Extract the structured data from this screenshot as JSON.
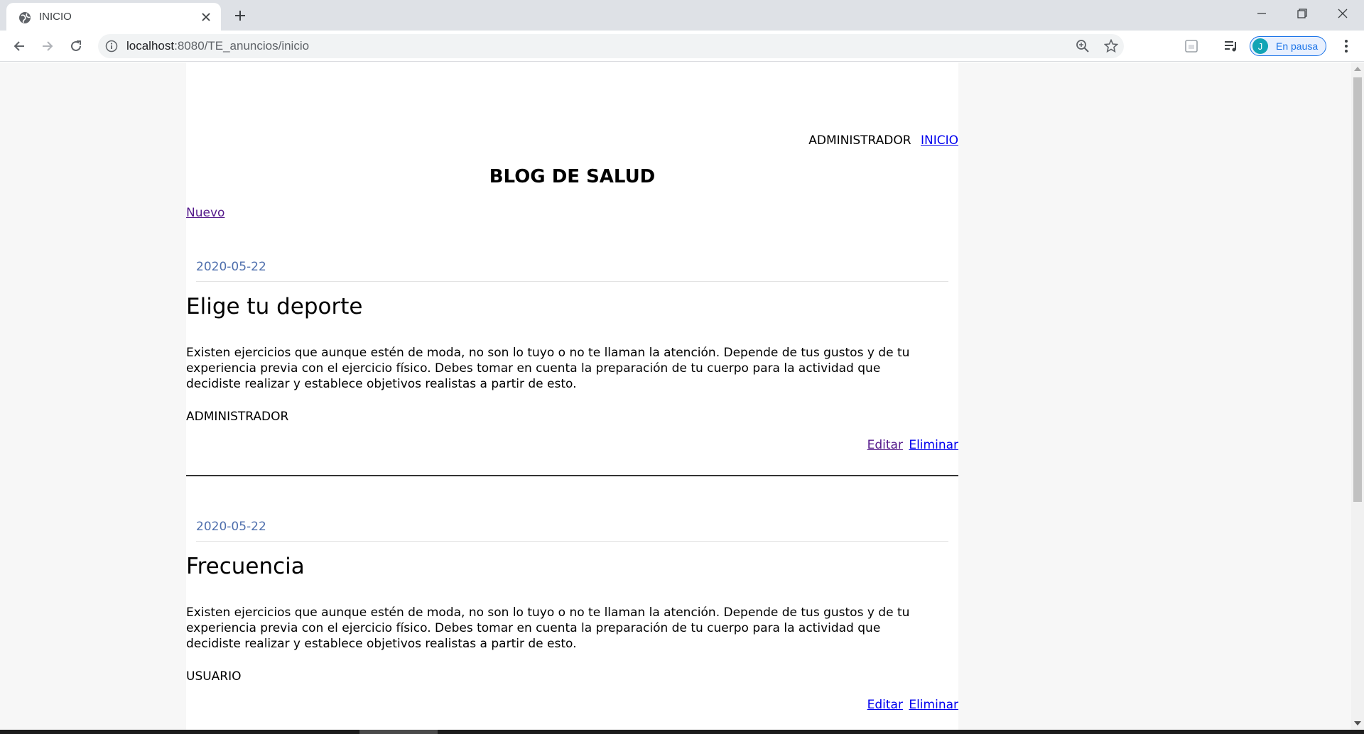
{
  "browser": {
    "tab_title": "INICIO",
    "url_host": "localhost",
    "url_rest": ":8080/TE_anuncios/inicio",
    "profile_initial": "J",
    "profile_label": "En pausa"
  },
  "header": {
    "role": "ADMINISTRADOR",
    "home_link": "INICIO"
  },
  "blog": {
    "title": "BLOG DE SALUD",
    "new_link": "Nuevo"
  },
  "posts": [
    {
      "date": "2020-05-22",
      "title": "Elige tu deporte",
      "body": "Existen ejercicios que aunque estén de moda, no son lo tuyo o no te llaman la atención. Depende de tus gustos y de tu experiencia previa con el ejercicio físico. Debes tomar en cuenta la preparación de tu cuerpo para la actividad que decidiste realizar y establece objetivos realistas a partir de esto.",
      "author": "ADMINISTRADOR",
      "edit_label": "Editar",
      "delete_label": "Eliminar"
    },
    {
      "date": "2020-05-22",
      "title": "Frecuencia",
      "body": "Existen ejercicios que aunque estén de moda, no son lo tuyo o no te llaman la atención. Depende de tus gustos y de tu experiencia previa con el ejercicio físico. Debes tomar en cuenta la preparación de tu cuerpo para la actividad que decidiste realizar y establece objetivos realistas a partir de esto.",
      "author": "USUARIO",
      "edit_label": "Editar",
      "delete_label": "Eliminar"
    }
  ],
  "icons": {
    "favicon": "globe-icon",
    "tab_close": "close-icon",
    "new_tab": "plus-icon",
    "back": "arrow-left-icon",
    "forward": "arrow-right-icon",
    "reload": "reload-icon",
    "site_info": "info-icon",
    "zoom": "zoom-icon",
    "bookmark": "star-icon",
    "extension": "extension-icon",
    "media": "media-control-icon",
    "menu": "kebab-menu-icon"
  },
  "colors": {
    "link": "#0000ee",
    "visited_link": "#551a8b",
    "date": "#4f6fad",
    "chrome_bg": "#dee1e6",
    "profile_accent": "#1a73e8"
  }
}
